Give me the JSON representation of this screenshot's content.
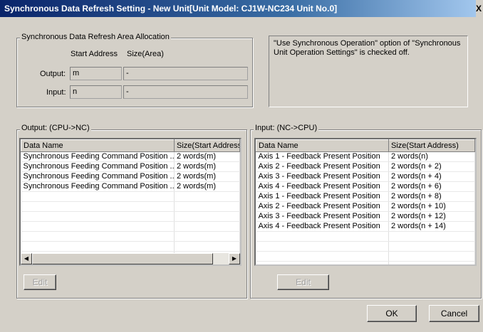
{
  "window": {
    "title": "Synchronous Data Refresh Setting - New Unit[Unit Model: CJ1W-NC234 Unit No.0]",
    "close_glyph": "X"
  },
  "allocation": {
    "group_label": "Synchronous Data Refresh Area Allocation",
    "col_start": "Start Address",
    "col_size": "Size(Area)",
    "output_label": "Output:",
    "output_start": "m",
    "output_size": "-",
    "input_label": "Input:",
    "input_start": "n",
    "input_size": "-"
  },
  "info_text": "\"Use Synchronous Operation\" option of \"Synchronous Unit Operation Settings\" is checked off.",
  "output": {
    "group_label": "Output: (CPU->NC)",
    "columns": [
      "Data Name",
      "Size(Start Address"
    ],
    "rows": [
      [
        "Synchronous Feeding Command Position ...",
        "2 words(m)"
      ],
      [
        "Synchronous Feeding Command Position ...",
        "2 words(m)"
      ],
      [
        "Synchronous Feeding Command Position ...",
        "2 words(m)"
      ],
      [
        "Synchronous Feeding Command Position ...",
        "2 words(m)"
      ],
      [
        "",
        ""
      ],
      [
        "",
        ""
      ],
      [
        "",
        ""
      ],
      [
        "",
        ""
      ],
      [
        "",
        ""
      ],
      [
        "",
        ""
      ],
      [
        "",
        ""
      ],
      [
        "",
        ""
      ],
      [
        "",
        ""
      ]
    ],
    "edit_label": "Edit"
  },
  "input": {
    "group_label": "Input: (NC->CPU)",
    "columns": [
      "Data Name",
      "Size(Start Address)"
    ],
    "rows": [
      [
        "Axis 1 - Feedback Present Position",
        "2 words(n)"
      ],
      [
        "Axis 2 - Feedback Present Position",
        "2 words(n + 2)"
      ],
      [
        "Axis 3 - Feedback Present Position",
        "2 words(n + 4)"
      ],
      [
        "Axis 4 - Feedback Present Position",
        "2 words(n + 6)"
      ],
      [
        "Axis 1 - Feedback Present Position",
        "2 words(n + 8)"
      ],
      [
        "Axis 2 - Feedback Present Position",
        "2 words(n + 10)"
      ],
      [
        "Axis 3 - Feedback Present Position",
        "2 words(n + 12)"
      ],
      [
        "Axis 4 - Feedback Present Position",
        "2 words(n + 14)"
      ],
      [
        "",
        ""
      ],
      [
        "",
        ""
      ],
      [
        "",
        ""
      ],
      [
        "",
        ""
      ]
    ],
    "edit_label": "Edit"
  },
  "buttons": {
    "ok": "OK",
    "cancel": "Cancel"
  },
  "icons": {
    "scroll_left": "scroll-left-arrow",
    "scroll_right": "scroll-right-arrow"
  }
}
